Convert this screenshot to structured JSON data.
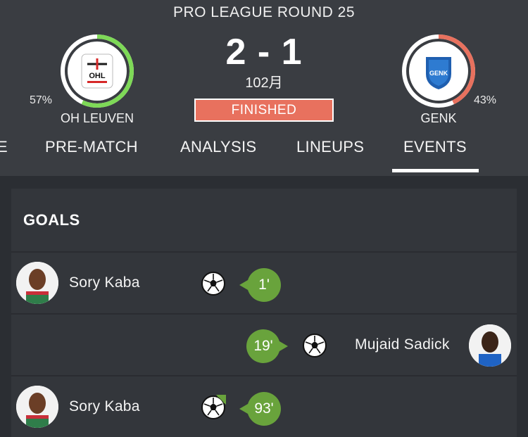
{
  "match": {
    "round_title": "PRO LEAGUE ROUND 25",
    "score": "2 - 1",
    "minute": "102月",
    "status": "FINISHED"
  },
  "home": {
    "name": "OH LEUVEN",
    "possession": "57%",
    "possession_fraction": 0.57,
    "logo_text": "OHL",
    "ring_color": "#7ed957"
  },
  "away": {
    "name": "GENK",
    "possession": "43%",
    "possession_fraction": 0.43,
    "logo_text": "GENK",
    "ring_color": "#e8715e"
  },
  "tabs": [
    {
      "label": "E"
    },
    {
      "label": "PRE-MATCH"
    },
    {
      "label": "ANALYSIS"
    },
    {
      "label": "LINEUPS"
    },
    {
      "label": "EVENTS",
      "active": true
    }
  ],
  "events": {
    "section_title": "GOALS",
    "goals": [
      {
        "player": "Sory Kaba",
        "minute": "1'",
        "side": "home",
        "type": "goal"
      },
      {
        "player": "Mujaid Sadick",
        "minute": "19'",
        "side": "away",
        "type": "goal"
      },
      {
        "player": "Sory Kaba",
        "minute": "93'",
        "side": "home",
        "type": "goal-with-arrow"
      }
    ]
  },
  "colors": {
    "accent_green": "#69a33c",
    "status_red": "#e8715e",
    "header_bg": "#3a3d42",
    "panel_bg": "#33363b"
  }
}
